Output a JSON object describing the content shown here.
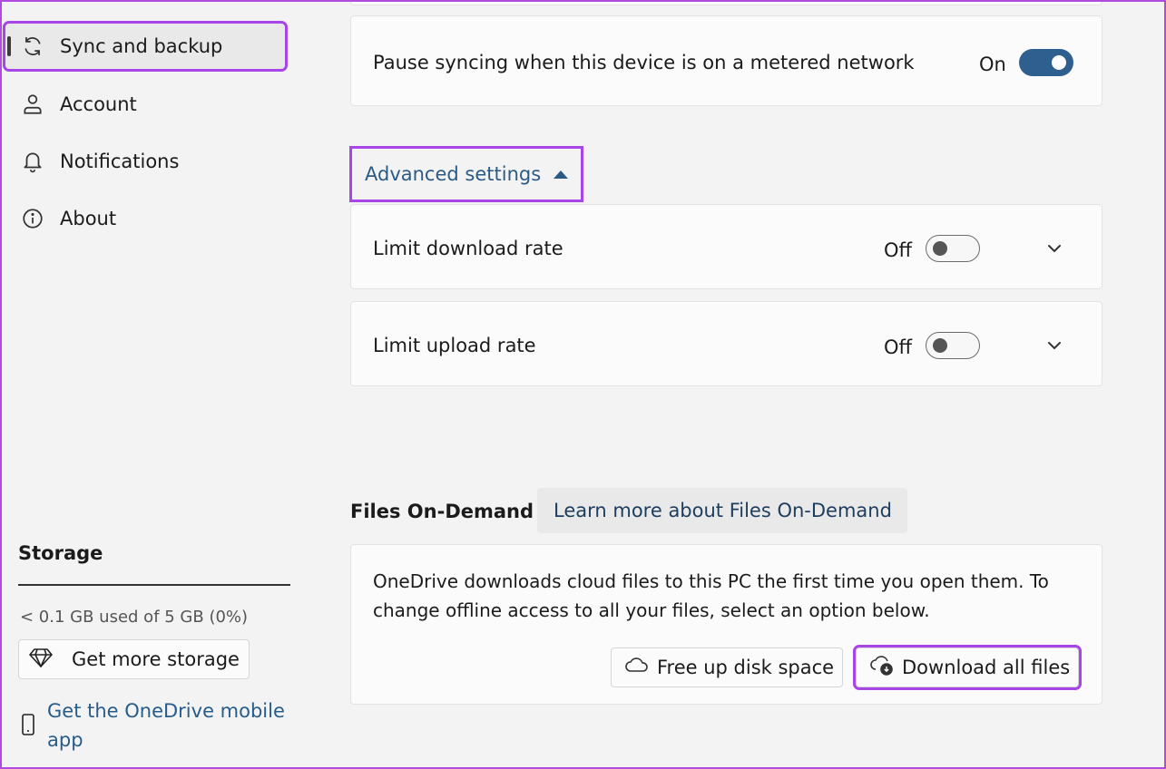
{
  "sidebar": {
    "items": [
      {
        "label": "Sync and backup",
        "icon": "sync-icon",
        "active": true
      },
      {
        "label": "Account",
        "icon": "person-icon"
      },
      {
        "label": "Notifications",
        "icon": "bell-icon"
      },
      {
        "label": "About",
        "icon": "info-icon"
      }
    ],
    "storage": {
      "title": "Storage",
      "used_text": "< 0.1 GB used of 5 GB (0%)",
      "used_fraction": 0,
      "get_more_label": "Get more storage"
    },
    "mobile_link": "Get the OneDrive mobile app"
  },
  "main": {
    "metered": {
      "label": "Pause syncing when this device is on a metered network",
      "state": "On"
    },
    "advanced": {
      "label": "Advanced settings",
      "items": [
        {
          "label": "Limit download rate",
          "state": "Off"
        },
        {
          "label": "Limit upload rate",
          "state": "Off"
        }
      ]
    },
    "files_on_demand": {
      "title": "Files On-Demand",
      "learn_more": "Learn more about Files On-Demand",
      "description": "OneDrive downloads cloud files to this PC the first time you open them. To change offline access to all your files, select an option below.",
      "free_up_label": "Free up disk space",
      "download_all_label": "Download all files"
    }
  },
  "colors": {
    "highlight": "#a745e6",
    "toggle_on": "#2f5f8f",
    "link": "#285c8b"
  }
}
